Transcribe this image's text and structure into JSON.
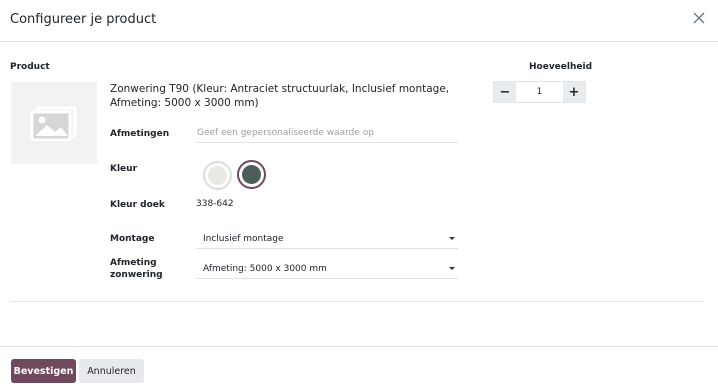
{
  "dialog": {
    "title": "Configureer je product",
    "close_icon": "close-icon"
  },
  "columns": {
    "product_label": "Product",
    "quantity_label": "Hoeveelheid"
  },
  "product": {
    "image_icon": "image-placeholder-icon",
    "name": "Zonwering T90 (Kleur: Antraciet structuurlak, Inclusief montage, Afmeting: 5000 x 3000 mm)"
  },
  "attributes": {
    "afmetingen": {
      "label": "Afmetingen",
      "value": "",
      "placeholder": "Geef een gepersonaliseerde waarde op"
    },
    "kleur": {
      "label": "Kleur",
      "swatches": [
        {
          "color": "#e9e8e3",
          "selected": false
        },
        {
          "color": "#4d5d5c",
          "selected": true
        }
      ]
    },
    "kleur_doek": {
      "label": "Kleur doek",
      "value": "338-642"
    },
    "montage": {
      "label": "Montage",
      "value": "Inclusief montage"
    },
    "afmeting_zonwering": {
      "label_line1": "Afmeting",
      "label_line2": "zonwering",
      "value": "Afmeting: 5000 x 3000 mm"
    }
  },
  "quantity": {
    "minus": "−",
    "plus": "+",
    "value": "1"
  },
  "footer": {
    "confirm_label": "Bevestigen",
    "cancel_label": "Annuleren"
  },
  "colors": {
    "primary": "#71495f",
    "secondary_button": "#e7e9ed"
  }
}
